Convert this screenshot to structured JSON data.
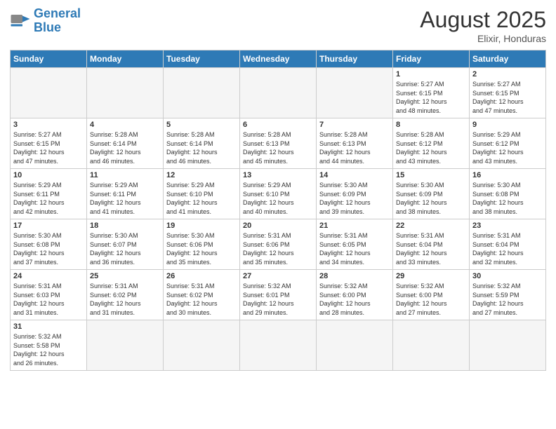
{
  "header": {
    "logo_general": "General",
    "logo_blue": "Blue",
    "month_year": "August 2025",
    "location": "Elixir, Honduras"
  },
  "weekdays": [
    "Sunday",
    "Monday",
    "Tuesday",
    "Wednesday",
    "Thursday",
    "Friday",
    "Saturday"
  ],
  "weeks": [
    [
      {
        "day": "",
        "empty": true
      },
      {
        "day": "",
        "empty": true
      },
      {
        "day": "",
        "empty": true
      },
      {
        "day": "",
        "empty": true
      },
      {
        "day": "",
        "empty": true
      },
      {
        "day": "1",
        "sunrise": "5:27 AM",
        "sunset": "6:15 PM",
        "daylight": "12 hours and 48 minutes."
      },
      {
        "day": "2",
        "sunrise": "5:27 AM",
        "sunset": "6:15 PM",
        "daylight": "12 hours and 47 minutes."
      }
    ],
    [
      {
        "day": "3",
        "sunrise": "5:27 AM",
        "sunset": "6:15 PM",
        "daylight": "12 hours and 47 minutes."
      },
      {
        "day": "4",
        "sunrise": "5:28 AM",
        "sunset": "6:14 PM",
        "daylight": "12 hours and 46 minutes."
      },
      {
        "day": "5",
        "sunrise": "5:28 AM",
        "sunset": "6:14 PM",
        "daylight": "12 hours and 46 minutes."
      },
      {
        "day": "6",
        "sunrise": "5:28 AM",
        "sunset": "6:13 PM",
        "daylight": "12 hours and 45 minutes."
      },
      {
        "day": "7",
        "sunrise": "5:28 AM",
        "sunset": "6:13 PM",
        "daylight": "12 hours and 44 minutes."
      },
      {
        "day": "8",
        "sunrise": "5:28 AM",
        "sunset": "6:12 PM",
        "daylight": "12 hours and 43 minutes."
      },
      {
        "day": "9",
        "sunrise": "5:29 AM",
        "sunset": "6:12 PM",
        "daylight": "12 hours and 43 minutes."
      }
    ],
    [
      {
        "day": "10",
        "sunrise": "5:29 AM",
        "sunset": "6:11 PM",
        "daylight": "12 hours and 42 minutes."
      },
      {
        "day": "11",
        "sunrise": "5:29 AM",
        "sunset": "6:11 PM",
        "daylight": "12 hours and 41 minutes."
      },
      {
        "day": "12",
        "sunrise": "5:29 AM",
        "sunset": "6:10 PM",
        "daylight": "12 hours and 41 minutes."
      },
      {
        "day": "13",
        "sunrise": "5:29 AM",
        "sunset": "6:10 PM",
        "daylight": "12 hours and 40 minutes."
      },
      {
        "day": "14",
        "sunrise": "5:30 AM",
        "sunset": "6:09 PM",
        "daylight": "12 hours and 39 minutes."
      },
      {
        "day": "15",
        "sunrise": "5:30 AM",
        "sunset": "6:09 PM",
        "daylight": "12 hours and 38 minutes."
      },
      {
        "day": "16",
        "sunrise": "5:30 AM",
        "sunset": "6:08 PM",
        "daylight": "12 hours and 38 minutes."
      }
    ],
    [
      {
        "day": "17",
        "sunrise": "5:30 AM",
        "sunset": "6:08 PM",
        "daylight": "12 hours and 37 minutes."
      },
      {
        "day": "18",
        "sunrise": "5:30 AM",
        "sunset": "6:07 PM",
        "daylight": "12 hours and 36 minutes."
      },
      {
        "day": "19",
        "sunrise": "5:30 AM",
        "sunset": "6:06 PM",
        "daylight": "12 hours and 35 minutes."
      },
      {
        "day": "20",
        "sunrise": "5:31 AM",
        "sunset": "6:06 PM",
        "daylight": "12 hours and 35 minutes."
      },
      {
        "day": "21",
        "sunrise": "5:31 AM",
        "sunset": "6:05 PM",
        "daylight": "12 hours and 34 minutes."
      },
      {
        "day": "22",
        "sunrise": "5:31 AM",
        "sunset": "6:04 PM",
        "daylight": "12 hours and 33 minutes."
      },
      {
        "day": "23",
        "sunrise": "5:31 AM",
        "sunset": "6:04 PM",
        "daylight": "12 hours and 32 minutes."
      }
    ],
    [
      {
        "day": "24",
        "sunrise": "5:31 AM",
        "sunset": "6:03 PM",
        "daylight": "12 hours and 31 minutes."
      },
      {
        "day": "25",
        "sunrise": "5:31 AM",
        "sunset": "6:02 PM",
        "daylight": "12 hours and 31 minutes."
      },
      {
        "day": "26",
        "sunrise": "5:31 AM",
        "sunset": "6:02 PM",
        "daylight": "12 hours and 30 minutes."
      },
      {
        "day": "27",
        "sunrise": "5:32 AM",
        "sunset": "6:01 PM",
        "daylight": "12 hours and 29 minutes."
      },
      {
        "day": "28",
        "sunrise": "5:32 AM",
        "sunset": "6:00 PM",
        "daylight": "12 hours and 28 minutes."
      },
      {
        "day": "29",
        "sunrise": "5:32 AM",
        "sunset": "6:00 PM",
        "daylight": "12 hours and 27 minutes."
      },
      {
        "day": "30",
        "sunrise": "5:32 AM",
        "sunset": "5:59 PM",
        "daylight": "12 hours and 27 minutes."
      }
    ],
    [
      {
        "day": "31",
        "sunrise": "5:32 AM",
        "sunset": "5:58 PM",
        "daylight": "12 hours and 26 minutes."
      },
      {
        "day": "",
        "empty": true
      },
      {
        "day": "",
        "empty": true
      },
      {
        "day": "",
        "empty": true
      },
      {
        "day": "",
        "empty": true
      },
      {
        "day": "",
        "empty": true
      },
      {
        "day": "",
        "empty": true
      }
    ]
  ]
}
